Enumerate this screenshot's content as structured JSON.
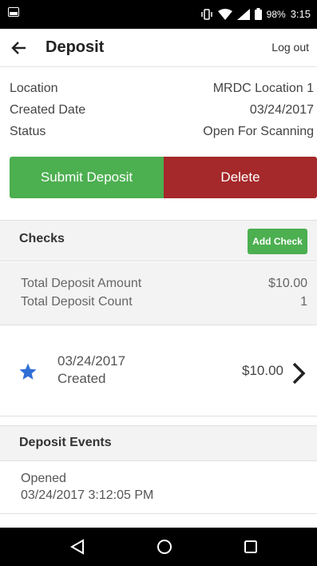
{
  "status_bar": {
    "battery_text": "98%",
    "time": "3:15"
  },
  "header": {
    "title": "Deposit",
    "logout_label": "Log out"
  },
  "info": [
    {
      "label": "Location",
      "value": "MRDC Location 1"
    },
    {
      "label": "Created Date",
      "value": "03/24/2017"
    },
    {
      "label": "Status",
      "value": "Open For Scanning"
    }
  ],
  "actions": {
    "submit_label": "Submit Deposit",
    "delete_label": "Delete"
  },
  "checks": {
    "title": "Checks",
    "add_label": "Add Check",
    "total_amount_label": "Total Deposit Amount",
    "total_amount_value": "$10.00",
    "total_count_label": "Total Deposit Count",
    "total_count_value": "1",
    "items": [
      {
        "date": "03/24/2017",
        "status": "Created",
        "amount": "$10.00"
      }
    ]
  },
  "events": {
    "title": "Deposit Events",
    "items": [
      {
        "name": "Opened",
        "timestamp": "03/24/2017 3:12:05 PM"
      }
    ]
  },
  "colors": {
    "green": "#4caf50",
    "red": "#a5282a",
    "star_blue": "#2f6fd6"
  }
}
